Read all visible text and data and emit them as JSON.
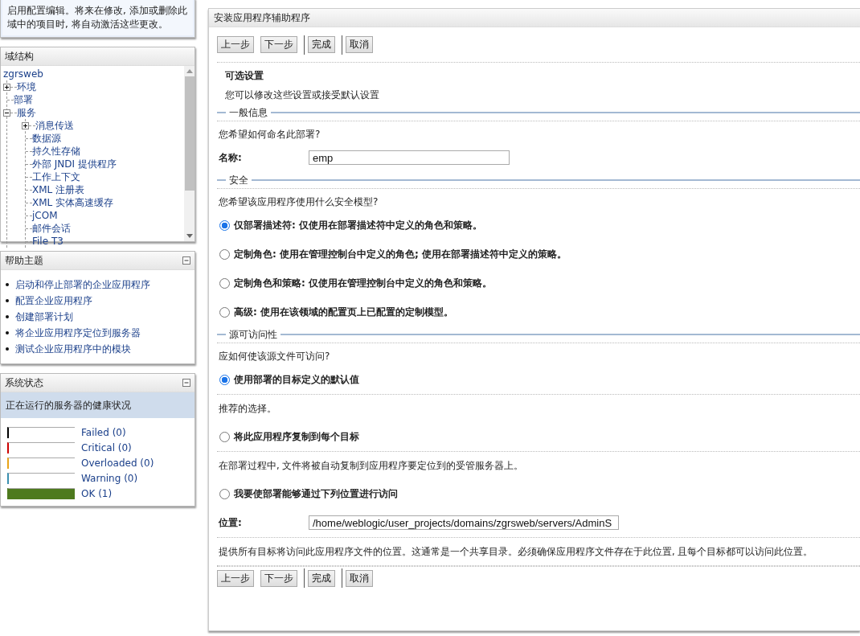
{
  "change_center": {
    "message": "启用配置编辑。将来在修改, 添加或删除此域中的项目时, 将自动激活这些更改。"
  },
  "domain_structure": {
    "title": "域结构",
    "tree": [
      {
        "label": "zgrsweb",
        "children": [
          {
            "label": "环境",
            "expanded": false
          },
          {
            "label": "部署"
          },
          {
            "label": "服务",
            "expanded": true,
            "children": [
              {
                "label": "消息传送",
                "expanded": false
              },
              {
                "label": "数据源"
              },
              {
                "label": "持久性存储"
              },
              {
                "label": "外部 JNDI 提供程序"
              },
              {
                "label": "工作上下文"
              },
              {
                "label": "XML 注册表"
              },
              {
                "label": "XML 实体高速缓存"
              },
              {
                "label": "jCOM"
              },
              {
                "label": "邮件会话"
              },
              {
                "label": "File T3"
              }
            ]
          }
        ]
      }
    ]
  },
  "help_topics": {
    "title": "帮助主题",
    "links": [
      "启动和停止部署的企业应用程序",
      "配置企业应用程序",
      "创建部署计划",
      "将企业应用程序定位到服务器",
      "测试企业应用程序中的模块"
    ]
  },
  "system_status": {
    "title": "系统状态",
    "subtitle": "正在运行的服务器的健康状况",
    "health": [
      {
        "label": "Failed (0)",
        "level": 0,
        "color": "#000000"
      },
      {
        "label": "Critical (0)",
        "level": 0,
        "color": "#cc0000"
      },
      {
        "label": "Overloaded (0)",
        "level": 0,
        "color": "#e8a317"
      },
      {
        "label": "Warning (0)",
        "level": 0,
        "color": "#3a8fb0"
      },
      {
        "label": "OK (1)",
        "level": 1,
        "color": "#4e7a1e"
      }
    ]
  },
  "wizard": {
    "title": "安装应用程序辅助程序",
    "buttons": [
      "上一步",
      "下一步",
      "完成",
      "取消"
    ],
    "heading": "可选设置",
    "subheading": "您可以修改这些设置或接受默认设置",
    "general": {
      "legend": "一般信息",
      "question": "您希望如何命名此部署?",
      "name_label": "名称:",
      "name_value": "emp"
    },
    "security": {
      "legend": "安全",
      "question": "您希望该应用程序使用什么安全模型?",
      "options": [
        {
          "label": "仅部署描述符: 仅使用在部署描述符中定义的角色和策略。",
          "selected": true
        },
        {
          "label": "定制角色: 使用在管理控制台中定义的角色; 使用在部署描述符中定义的策略。",
          "selected": false
        },
        {
          "label": "定制角色和策略: 仅使用在管理控制台中定义的角色和策略。",
          "selected": false
        },
        {
          "label": "高级: 使用在该领域的配置页上已配置的定制模型。",
          "selected": false
        }
      ]
    },
    "source_access": {
      "legend": "源可访问性",
      "question": "应如何使该源文件可访问?",
      "options": [
        {
          "label": "使用部署的目标定义的默认值",
          "selected": true,
          "hint": "推荐的选择。"
        },
        {
          "label": "将此应用程序复制到每个目标",
          "selected": false,
          "hint": "在部署过程中, 文件将被自动复制到应用程序要定位到的受管服务器上。"
        },
        {
          "label": "我要使部署能够通过下列位置进行访问",
          "selected": false,
          "field_label": "位置:",
          "field_value": "/home/weblogic/user_projects/domains/zgrsweb/servers/AdminS",
          "hint": "提供所有目标将访问此应用程序文件的位置。这通常是一个共享目录。必须确保应用程序文件存在于此位置, 且每个目标都可以访问此位置。"
        }
      ]
    },
    "bottom_buttons": [
      "上一步",
      "下一步",
      "完成",
      "取消"
    ]
  }
}
